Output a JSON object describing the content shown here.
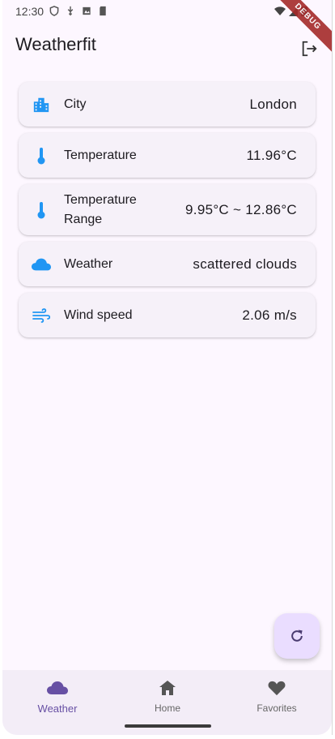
{
  "status_bar": {
    "time": "12:30",
    "icons": [
      "shield-icon",
      "usb-icon",
      "photo-icon",
      "sdcard-icon"
    ],
    "right_icons": [
      "wifi-icon",
      "signal-icon",
      "battery-icon"
    ],
    "debug_label": "DEBUG"
  },
  "app_bar": {
    "title": "Weatherfit",
    "action_icon": "logout-icon"
  },
  "cards": [
    {
      "icon": "city-icon",
      "label": "City",
      "value": "London"
    },
    {
      "icon": "thermometer-icon",
      "label": "Temperature",
      "value": "11.96°C"
    },
    {
      "icon": "thermometer-icon",
      "label": "Temperature Range",
      "value": "9.95°C ~ 12.86°C"
    },
    {
      "icon": "cloud-icon",
      "label": "Weather",
      "value": "scattered clouds"
    },
    {
      "icon": "wind-icon",
      "label": "Wind speed",
      "value": "2.06 m/s"
    }
  ],
  "fab": {
    "icon": "refresh-icon"
  },
  "bottom_nav": {
    "items": [
      {
        "icon": "cloud-icon",
        "label": "Weather",
        "selected": true
      },
      {
        "icon": "home-icon",
        "label": "Home",
        "selected": false
      },
      {
        "icon": "heart-icon",
        "label": "Favorites",
        "selected": false
      }
    ]
  },
  "colors": {
    "accent": "#6750a4",
    "icon_blue": "#2196f3",
    "background": "#fdf7ff",
    "card": "#f6f1f9",
    "fab": "#eaddff",
    "nav": "#f3edf7"
  }
}
